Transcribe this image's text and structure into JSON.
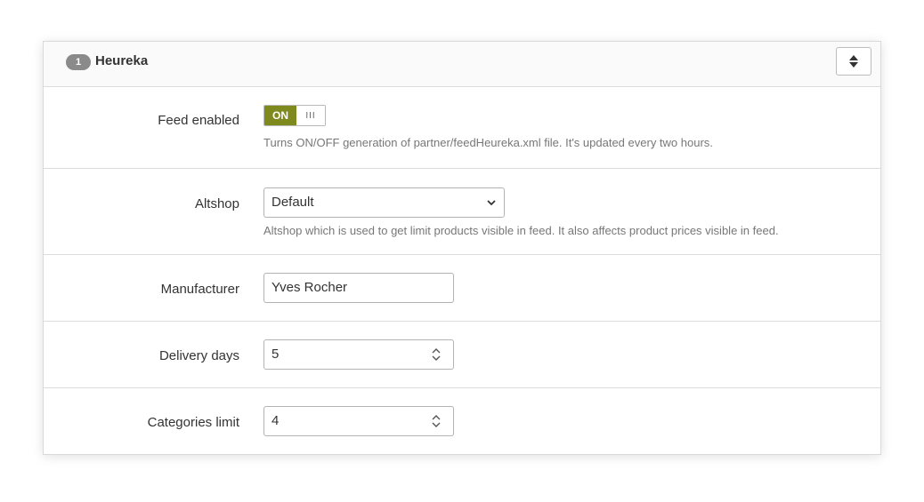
{
  "panel": {
    "badge": "1",
    "title": "Heureka"
  },
  "fields": {
    "feed_enabled": {
      "label": "Feed enabled",
      "on_text": "ON",
      "off_text": "III",
      "help": "Turns ON/OFF generation of partner/feedHeureka.xml file. It's updated every two hours."
    },
    "altshop": {
      "label": "Altshop",
      "selected": "Default",
      "help": "Altshop which is used to get limit products visible in feed. It also affects product prices visible in feed."
    },
    "manufacturer": {
      "label": "Manufacturer",
      "value": "Yves Rocher"
    },
    "delivery_days": {
      "label": "Delivery days",
      "value": "5"
    },
    "categories_limit": {
      "label": "Categories limit",
      "value": "4"
    }
  },
  "colors": {
    "switch_on": "#7f8a1e",
    "badge": "#8a8a8a"
  },
  "icons": {
    "panel_toggle": "sort-icon",
    "select_arrow": "chevron-down-icon",
    "spinner": "spinner-icon"
  }
}
